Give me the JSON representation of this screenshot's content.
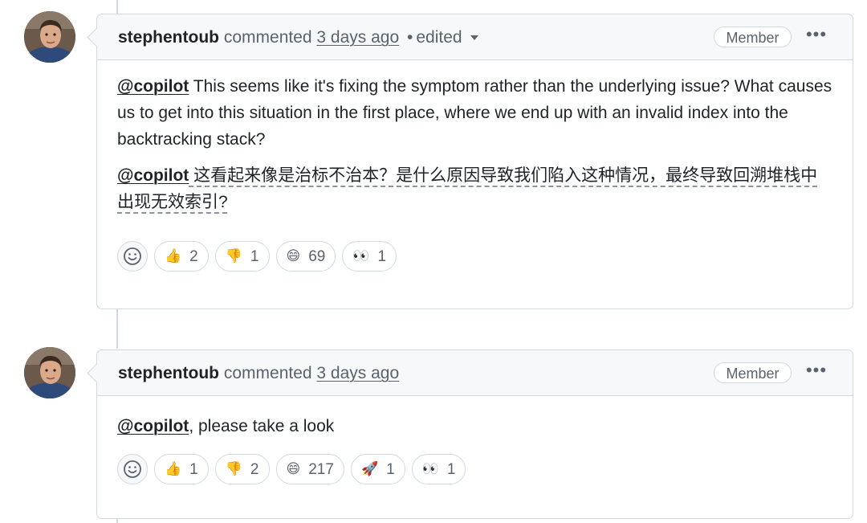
{
  "comments": [
    {
      "author": "stephentoub",
      "action": "commented",
      "time": "3 days ago",
      "separator": "•",
      "edited": "edited",
      "badge": "Member",
      "more": "•••",
      "body": {
        "p1_mention": "@copilot",
        "p1_text": " This seems like it's fixing the symptom rather than the underlying issue? What causes us to get into this situation in the first place, where we end up with an invalid index into the backtracking stack?",
        "p2_mention": "@copilot",
        "p2_text": " 这看起来像是治标不治本？是什么原因导致我们陷入这种情况，最终导致回溯堆栈中出现无效索引?"
      },
      "reactions": [
        {
          "icon": "thumbs-up-icon",
          "emoji": "👍",
          "count": "2"
        },
        {
          "icon": "thumbs-down-icon",
          "emoji": "👎",
          "count": "1"
        },
        {
          "icon": "laugh-icon",
          "emoji": "😄",
          "count": "69"
        },
        {
          "icon": "eyes-icon",
          "emoji": "👀",
          "count": "1"
        }
      ]
    },
    {
      "author": "stephentoub",
      "action": "commented",
      "time": "3 days ago",
      "badge": "Member",
      "more": "•••",
      "body": {
        "p1_mention": "@copilot",
        "p1_text": ", please take a look"
      },
      "reactions": [
        {
          "icon": "thumbs-up-icon",
          "emoji": "👍",
          "count": "1"
        },
        {
          "icon": "thumbs-down-icon",
          "emoji": "👎",
          "count": "2"
        },
        {
          "icon": "laugh-icon",
          "emoji": "😄",
          "count": "217"
        },
        {
          "icon": "rocket-icon",
          "emoji": "🚀",
          "count": "1"
        },
        {
          "icon": "eyes-icon",
          "emoji": "👀",
          "count": "1"
        }
      ]
    }
  ],
  "colors": {
    "border": "#d1d9e0",
    "header_bg": "#f6f8fa",
    "muted_text": "#59636e",
    "text": "#1f2328"
  }
}
